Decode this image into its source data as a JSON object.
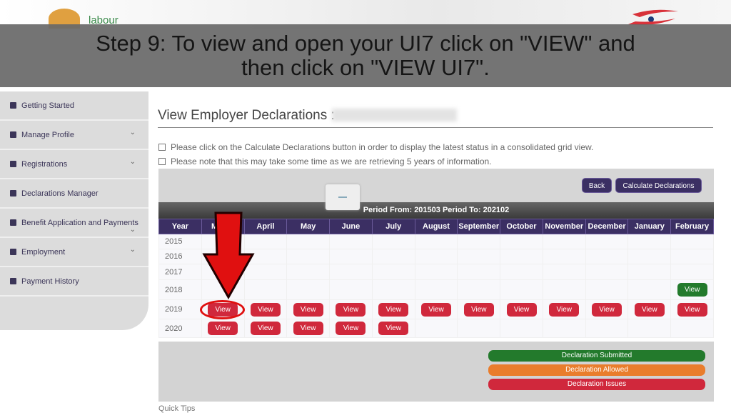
{
  "header": {
    "logo_text": "labour"
  },
  "caption": {
    "line1": "Step 9: To view and open your UI7 click on \"VIEW\" and",
    "line2": "then click on \"VIEW UI7\"."
  },
  "sidebar": {
    "items": [
      {
        "label": "Getting Started",
        "icon": "flag-icon",
        "chevron": false
      },
      {
        "label": "Manage Profile",
        "icon": "sitemap-icon",
        "chevron": true
      },
      {
        "label": "Registrations",
        "icon": "list-icon",
        "chevron": true
      },
      {
        "label": "Declarations Manager",
        "icon": "document-icon",
        "chevron": false
      },
      {
        "label": "Benefit Application and Payments",
        "icon": "document-icon",
        "chevron": true
      },
      {
        "label": "Employment",
        "icon": "user-icon",
        "chevron": true
      },
      {
        "label": "Payment History",
        "icon": "receipt-icon",
        "chevron": false
      }
    ]
  },
  "main": {
    "title": "View Employer Declarations :",
    "notes": [
      "Please click on the Calculate Declarations button in order to display the latest status in a consolidated grid view.",
      "Please note that this may take some time as we are retrieving 5 years of information."
    ],
    "back_label": "Back",
    "calculate_label": "Calculate Declarations",
    "period": "Period From: 201503 Period To: 202102",
    "columns": [
      "Year",
      "March",
      "April",
      "May",
      "June",
      "July",
      "August",
      "September",
      "October",
      "November",
      "December",
      "January",
      "February"
    ],
    "view_label": "View",
    "rows": [
      {
        "year": "2015",
        "cells": [
          "",
          "",
          "",
          "",
          "",
          "",
          "",
          "",
          "",
          "",
          "",
          ""
        ]
      },
      {
        "year": "2016",
        "cells": [
          "",
          "",
          "",
          "",
          "",
          "",
          "",
          "",
          "",
          "",
          "",
          ""
        ]
      },
      {
        "year": "2017",
        "cells": [
          "",
          "",
          "",
          "",
          "",
          "",
          "",
          "",
          "",
          "",
          "",
          ""
        ]
      },
      {
        "year": "2018",
        "cells": [
          "",
          "",
          "",
          "",
          "",
          "",
          "",
          "",
          "",
          "",
          "",
          "submitted"
        ]
      },
      {
        "year": "2019",
        "cells": [
          "issues",
          "issues",
          "issues",
          "issues",
          "issues",
          "issues",
          "issues",
          "issues",
          "issues",
          "issues",
          "issues",
          "issues"
        ]
      },
      {
        "year": "2020",
        "cells": [
          "issues",
          "issues",
          "issues",
          "issues",
          "issues",
          "",
          "",
          "",
          "",
          "",
          "",
          ""
        ]
      }
    ],
    "legend": [
      {
        "label": "Declaration Submitted",
        "status": "submitted"
      },
      {
        "label": "Declaration Allowed",
        "status": "allowed"
      },
      {
        "label": "Declaration Issues",
        "status": "issues"
      }
    ],
    "quick_tips": "Quick Tips"
  },
  "colors": {
    "submitted": "#237a2c",
    "allowed": "#e97d2c",
    "issues": "#d0283c",
    "header": "#3b2f63",
    "arrow": "#e01010"
  }
}
